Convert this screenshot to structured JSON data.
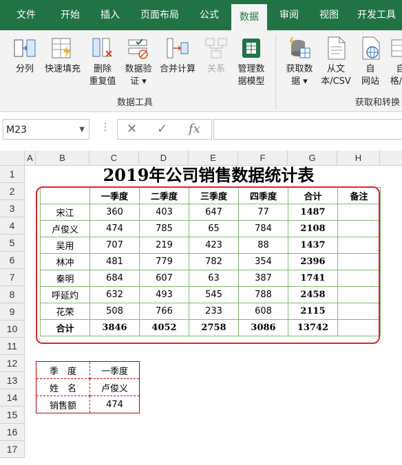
{
  "tabs": [
    "文件",
    "开始",
    "插入",
    "页面布局",
    "公式",
    "数据",
    "审阅",
    "视图",
    "开发工具"
  ],
  "active_tab": "数据",
  "ribbon": {
    "items": [
      {
        "label1": "分列",
        "label2": ""
      },
      {
        "label1": "快速填充",
        "label2": ""
      },
      {
        "label1": "删除",
        "label2": "重复值"
      },
      {
        "label1": "数据验",
        "label2": "证 ▾"
      },
      {
        "label1": "合并计算",
        "label2": ""
      },
      {
        "label1": "关系",
        "label2": "",
        "disabled": true
      },
      {
        "label1": "管理数",
        "label2": "据模型"
      },
      {
        "label1": "获取数",
        "label2": "据 ▾"
      },
      {
        "label1": "从文",
        "label2": "本/CSV"
      },
      {
        "label1": "自",
        "label2": "网站"
      },
      {
        "label1": "自",
        "label2": "格/区"
      }
    ],
    "group1_label": "数据工具",
    "group2_label": "获取和转换"
  },
  "formula_bar": {
    "name_box": "M23",
    "cancel_icon": "✕",
    "enter_icon": "✓",
    "fx_label": "fx",
    "formula": ""
  },
  "columns": [
    "A",
    "B",
    "C",
    "D",
    "E",
    "F",
    "G",
    "H"
  ],
  "rows": [
    "1",
    "2",
    "3",
    "4",
    "5",
    "6",
    "7",
    "8",
    "9",
    "10",
    "11",
    "12",
    "13",
    "14",
    "15",
    "16",
    "17"
  ],
  "sheet": {
    "title": "2019年公司销售数据统计表",
    "headers": [
      "",
      "一季度",
      "二季度",
      "三季度",
      "四季度",
      "合计",
      "备注"
    ],
    "data_rows": [
      [
        "宋江",
        "360",
        "403",
        "647",
        "77",
        "1487",
        ""
      ],
      [
        "卢俊义",
        "474",
        "785",
        "65",
        "784",
        "2108",
        ""
      ],
      [
        "吴用",
        "707",
        "219",
        "423",
        "88",
        "1437",
        ""
      ],
      [
        "林冲",
        "481",
        "779",
        "782",
        "354",
        "2396",
        ""
      ],
      [
        "秦明",
        "684",
        "607",
        "63",
        "387",
        "1741",
        ""
      ],
      [
        "呼延灼",
        "632",
        "493",
        "545",
        "788",
        "2458",
        ""
      ],
      [
        "花荣",
        "508",
        "766",
        "233",
        "608",
        "2115",
        ""
      ]
    ],
    "total_row": [
      "合计",
      "3846",
      "4052",
      "2758",
      "3086",
      "13742",
      ""
    ]
  },
  "lookup": {
    "rows": [
      [
        "季　度",
        "一季度"
      ],
      [
        "姓　名",
        "卢俊义"
      ],
      [
        "销售额",
        "474"
      ]
    ]
  },
  "colors": {
    "accent": "#217346",
    "frame_red": "#e2222b",
    "border_green": "#7fba6e",
    "dashed_red": "#c00000"
  }
}
